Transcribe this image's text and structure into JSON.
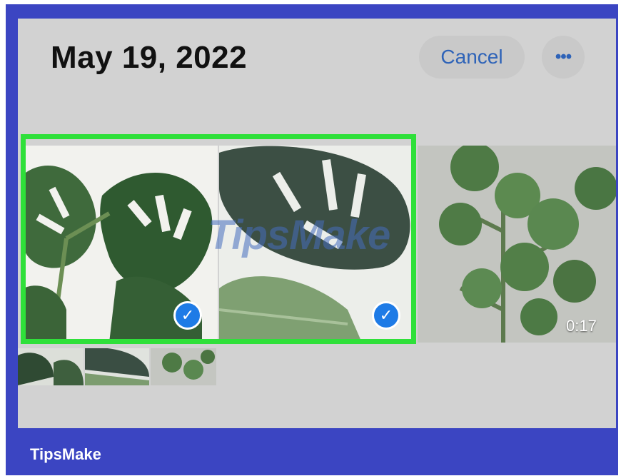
{
  "header": {
    "date_title": "May 19, 2022",
    "cancel_label": "Cancel",
    "more_label": "•••"
  },
  "photos": [
    {
      "name": "monstera-photo-1",
      "selected": true
    },
    {
      "name": "monstera-photo-2",
      "selected": true
    },
    {
      "name": "eucalyptus-video",
      "selected": false,
      "duration": "0:17"
    }
  ],
  "check_glyph": "✓",
  "watermark": "TipsMake",
  "footer": {
    "brand": "TipsMake"
  },
  "colors": {
    "border": "#3b45c2",
    "selection": "#2fe03a",
    "accent": "#2e63b8",
    "check": "#1e7be6"
  }
}
